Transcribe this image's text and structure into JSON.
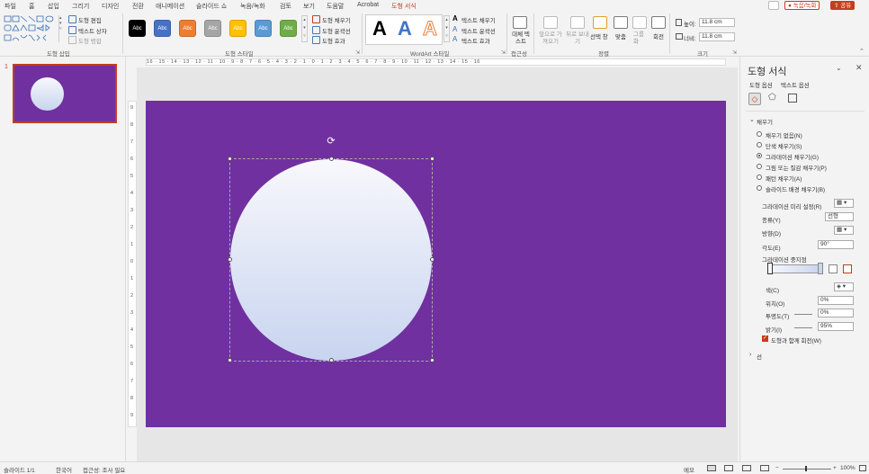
{
  "menu": {
    "items": [
      "파일",
      "홈",
      "삽입",
      "그리기",
      "디자인",
      "전환",
      "애니메이션",
      "슬라이드 쇼",
      "녹음/녹화",
      "검토",
      "보기",
      "도움말",
      "Acrobat",
      "도형 서식"
    ],
    "record_button": "녹음/녹화",
    "share_button": "공유"
  },
  "ribbon": {
    "insert_shapes": {
      "label": "도형 삽입",
      "edit_shape": "도형 편집",
      "text_box": "텍스트 상자",
      "merge_shapes": "도형 병합"
    },
    "shape_styles": {
      "label": "도형 스타일",
      "swatch_text": "Abc",
      "swatch_colors": [
        "#000000",
        "#4472c4",
        "#ed7d31",
        "#a5a5a5",
        "#ffc000",
        "#5b9bd5",
        "#70ad47"
      ],
      "shape_fill": "도형 채우기",
      "shape_outline": "도형 윤곽선",
      "shape_effects": "도형 효과"
    },
    "wordart": {
      "label": "WordArt 스타일",
      "letters": [
        "A",
        "A",
        "A"
      ],
      "text_fill": "텍스트 채우기",
      "text_outline": "텍스트 윤곽선",
      "text_effects": "텍스트 효과"
    },
    "accessibility": {
      "label": "접근성",
      "alt_text": "대체 텍스트"
    },
    "arrange": {
      "label": "정렬",
      "bring_forward": "앞으로 가져오기",
      "send_backward": "뒤로 보내기",
      "selection_pane": "선택 창",
      "align": "맞춤",
      "group": "그룹화",
      "rotate": "회전"
    },
    "size": {
      "label": "크기",
      "height_label": "높이:",
      "height_value": "11.8 cm",
      "width_label": "너비:",
      "width_value": "11.8 cm"
    }
  },
  "ruler_h_text": "16 · 15 · 14 · 13 · 12 · 11 · 10 · 9 · 8 · 7 · 6 · 5 · 4 · 3 · 2 · 1 · 0 · 1 · 2 · 3 · 4 · 5 · 6 · 7 · 8 · 9 · 10 · 11 · 12 · 13 · 14 · 15 · 16",
  "ruler_v_ticks": [
    "9",
    "8",
    "7",
    "6",
    "5",
    "4",
    "3",
    "2",
    "1",
    "0",
    "1",
    "2",
    "3",
    "4",
    "5",
    "6",
    "7",
    "8",
    "9"
  ],
  "thumbnail": {
    "number": "1"
  },
  "slide": {
    "background": "#7030a0",
    "circle_gradient_top": "#f8f8fc",
    "circle_gradient_bottom": "#c8d4ef"
  },
  "pane": {
    "title": "도형 서식",
    "tab_shape": "도형 옵션",
    "tab_text": "텍스트 옵션",
    "fill_section": "채우기",
    "fill_options": [
      "채우기 없음(N)",
      "단색 채우기(S)",
      "그라데이션 채우기(G)",
      "그림 또는 질감 채우기(P)",
      "패턴 채우기(A)",
      "슬라이드 배경 채우기(B)"
    ],
    "selected_fill": 2,
    "preset_label": "그라데이션 미리 설정(R)",
    "type_label": "종류(Y)",
    "type_value": "선형",
    "direction_label": "방향(D)",
    "angle_label": "각도(E)",
    "angle_value": "90°",
    "stops_label": "그라데이션 중지점",
    "color_label": "색(C)",
    "position_label": "위치(O)",
    "position_value": "0%",
    "transparency_label": "투명도(T)",
    "transparency_value": "0%",
    "brightness_label": "밝기(I)",
    "brightness_value": "95%",
    "rotate_with_shape": "도형과 함께 회전(W)",
    "line_section": "선"
  },
  "status": {
    "slide_info": "슬라이드 1/1",
    "language": "한국어",
    "accessibility": "접근성: 조사 필요",
    "notes": "메모",
    "zoom": "100%"
  }
}
